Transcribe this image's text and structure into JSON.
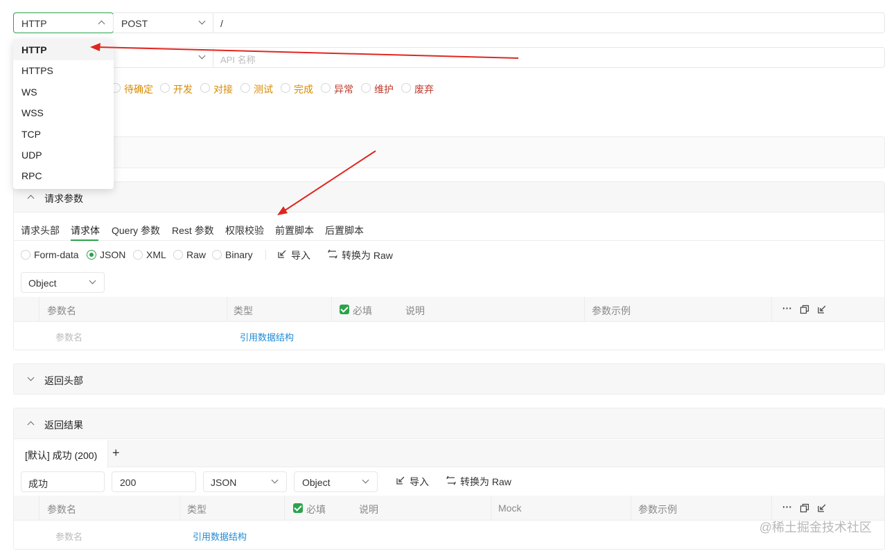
{
  "request_line": {
    "protocol": "HTTP",
    "method": "POST",
    "path": "/"
  },
  "protocol_dropdown": {
    "options": [
      "HTTP",
      "HTTPS",
      "WS",
      "WSS",
      "TCP",
      "UDP",
      "RPC"
    ],
    "selected": "HTTP"
  },
  "api_name": {
    "placeholder": "API 名称"
  },
  "status": {
    "options": [
      {
        "label": "待确定",
        "color": "#d98a00"
      },
      {
        "label": "开发",
        "color": "#d98a00"
      },
      {
        "label": "对接",
        "color": "#d98a00"
      },
      {
        "label": "测试",
        "color": "#d98a00"
      },
      {
        "label": "完成",
        "color": "#d98a00"
      },
      {
        "label": "异常",
        "color": "#c0392b"
      },
      {
        "label": "维护",
        "color": "#c0392b"
      },
      {
        "label": "废弃",
        "color": "#c0392b"
      }
    ]
  },
  "request_params": {
    "title": "请求参数",
    "tabs": [
      "请求头部",
      "请求体",
      "Query 参数",
      "Rest 参数",
      "权限校验",
      "前置脚本",
      "后置脚本"
    ],
    "active_tab": "请求体",
    "body_types": [
      "Form-data",
      "JSON",
      "XML",
      "Raw",
      "Binary"
    ],
    "selected_body_type": "JSON",
    "import_label": "导入",
    "convert_label": "转换为 Raw",
    "root_type": "Object",
    "table": {
      "headers": [
        "参数名",
        "类型",
        "必填",
        "说明",
        "参数示例"
      ],
      "more": "···",
      "row": {
        "name_placeholder": "参数名",
        "ref_link": "引用数据结构"
      }
    }
  },
  "response_headers": {
    "title": "返回头部"
  },
  "response_result": {
    "title": "返回结果",
    "tab_label": "[默认] 成功 (200)",
    "add_tab": "+",
    "name_value": "成功",
    "code_value": "200",
    "content_type": "JSON",
    "root_type": "Object",
    "import_label": "导入",
    "convert_label": "转换为 Raw",
    "table": {
      "headers": [
        "参数名",
        "类型",
        "必填",
        "说明",
        "Mock",
        "参数示例"
      ],
      "more": "···",
      "row": {
        "name_placeholder": "参数名",
        "ref_link": "引用数据结构"
      }
    }
  },
  "watermark": "@稀土掘金技术社区",
  "accent_color": "#2aa34a",
  "annotation_arrow_color": "#e0251f"
}
